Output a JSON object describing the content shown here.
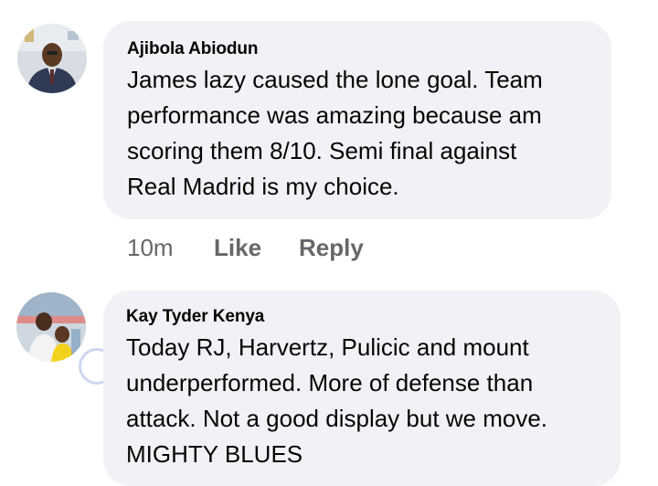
{
  "comments": [
    {
      "author": "Ajibola Abiodun",
      "lines": [
        "James lazy caused the lone goal. Team",
        "performance was amazing because am",
        "scoring them 8/10. Semi final against",
        "Real Madrid is my choice."
      ],
      "time": "10m",
      "like_label": "Like",
      "reply_label": "Reply"
    },
    {
      "author": "Kay Tyder Kenya",
      "lines": [
        "Today RJ, Harvertz, Pulicic and mount",
        "underperformed. More of defense than",
        "attack. Not a good display but we move.",
        "MIGHTY BLUES"
      ]
    }
  ],
  "colors": {
    "bubble": "#f0f2f5",
    "text": "#050505",
    "meta": "#65676b"
  }
}
